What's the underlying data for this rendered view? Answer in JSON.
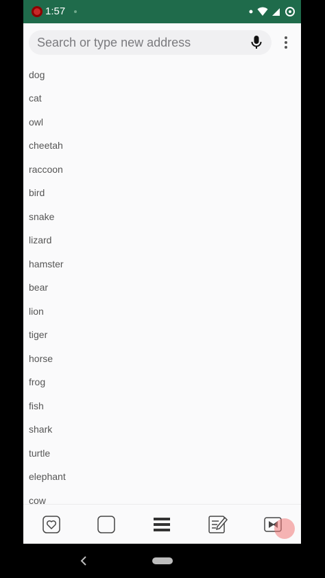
{
  "status_bar": {
    "time": "1:57",
    "background": "#1f6b4b",
    "icons": [
      "record-icon",
      "wifi-icon",
      "signal-icon",
      "data-saver-icon"
    ]
  },
  "toolbar": {
    "search_placeholder": "Search or type new address",
    "mic_icon": "microphone-icon",
    "menu_icon": "more-vertical-icon"
  },
  "content": {
    "words": [
      "dog",
      "cat",
      "owl",
      "cheetah",
      "raccoon",
      "bird",
      "snake",
      "lizard",
      "hamster",
      "bear",
      "lion",
      "tiger",
      "horse",
      "frog",
      "fish",
      "shark",
      "turtle",
      "elephant",
      "cow"
    ]
  },
  "bottom_bar": {
    "buttons": [
      "favorites-icon",
      "tabs-icon",
      "hamburger-menu-icon",
      "notes-icon",
      "video-icon"
    ]
  },
  "nav_bar": {
    "buttons": [
      "back-icon",
      "home-pill-icon"
    ]
  }
}
